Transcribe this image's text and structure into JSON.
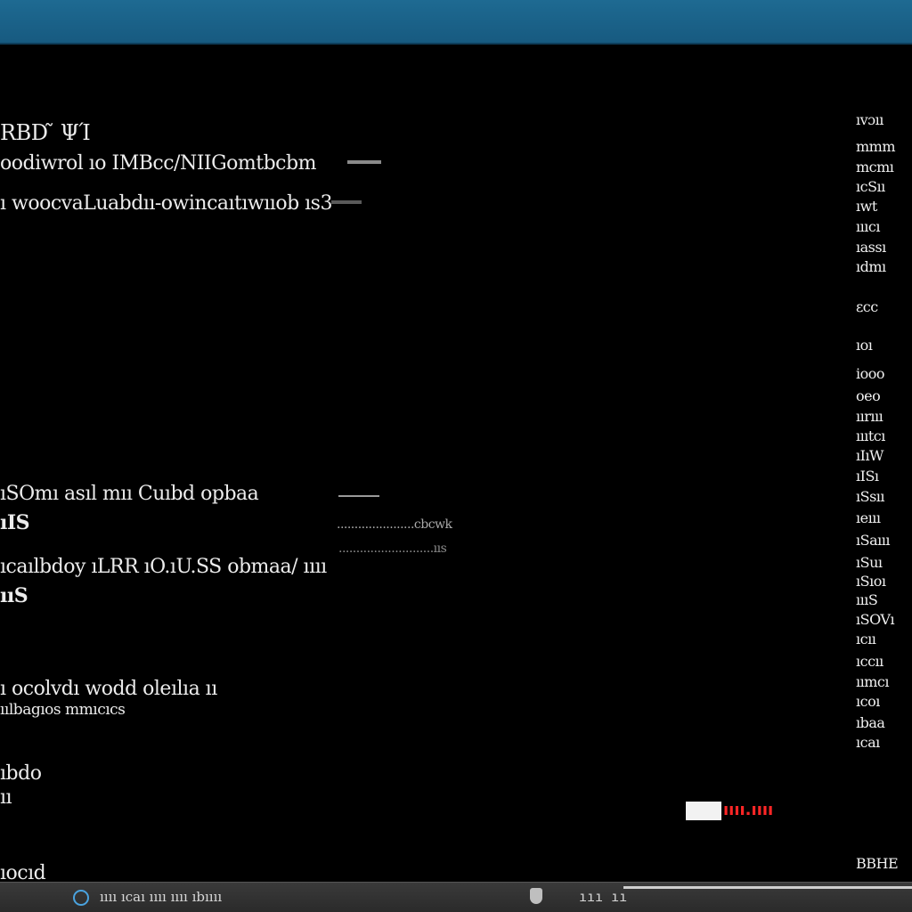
{
  "window": {
    "title_bar_color": "#1e6a92"
  },
  "console": {
    "header": "RBD ̃ ΨΊ",
    "lines": [
      "oodiwrol ıo IMBcc/NIIGomtbcbm",
      "ı woocvaLuabdıı-owincaıtıwııob ıs3",
      "ıSOmı asıl mıı Cuıbd opbaa",
      "ıIS",
      "ıcaılbdoy ıLRR ıO.ıU.SS obmaa/ ıııı",
      "ııS",
      "ı ocolvdı wodd oleılıa ıı",
      "ıılbagıos mmıcıcs",
      "ıbdo",
      "ıı",
      "ıocıd"
    ],
    "small_lines": [
      "......................cbcwk",
      "...........................ııs"
    ],
    "status": {
      "text": "ıııı.ıııı",
      "color": "#ff2626"
    }
  },
  "sidebar": {
    "items": [
      "ıvɔıı",
      "mmm",
      "mcmı",
      "ıcSıı",
      "ıwt",
      "ıııcı",
      "ıassı",
      "ıdmı",
      "εcc",
      "ıoı",
      "iooo",
      "oeo",
      "ıırııı",
      "ıııtcı",
      "ıIıW",
      "ıISı",
      "ıSsıı",
      "ıeııı",
      "ıSaııı",
      "ıSuı",
      "ıSıoı",
      "ıııS",
      "ıSOVı",
      "ıcıı",
      "ıccıı",
      "ıımcı",
      "ıcoı",
      "ıbaa",
      "ıcaı",
      "BBHE"
    ]
  },
  "taskbar": {
    "start_text": "ıııı ıcaı ıııı ıııı ıbıııı",
    "right_text": "ııı ıı"
  }
}
